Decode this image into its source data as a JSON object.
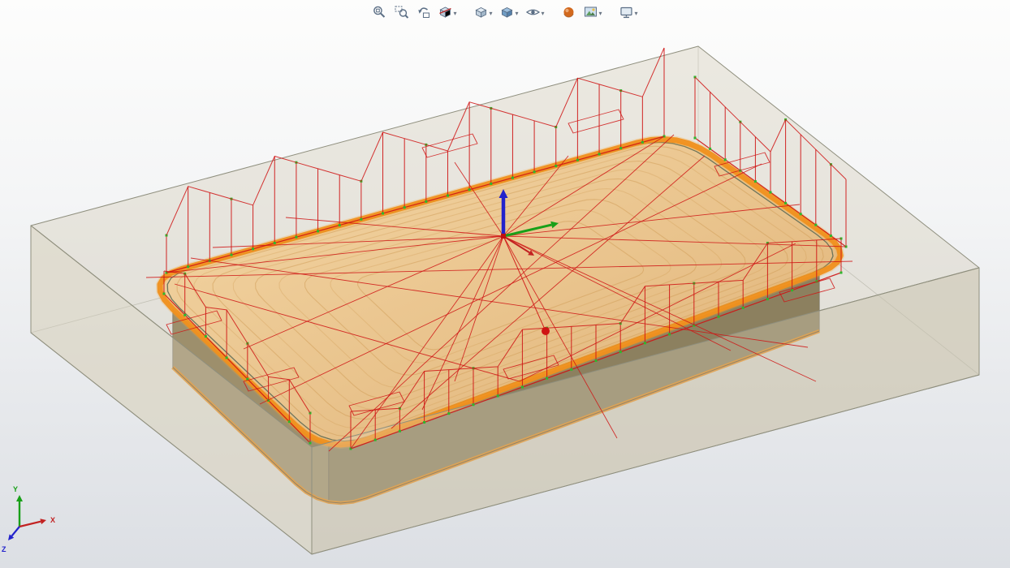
{
  "toolbar": {
    "items": [
      {
        "name": "zoom-to-fit",
        "dropdown": false,
        "group_start": false
      },
      {
        "name": "zoom-to-area",
        "dropdown": false,
        "group_start": false
      },
      {
        "name": "previous-view",
        "dropdown": false,
        "group_start": false
      },
      {
        "name": "section-view",
        "dropdown": true,
        "group_start": false
      },
      {
        "name": "view-orientation",
        "dropdown": true,
        "group_start": true
      },
      {
        "name": "display-style",
        "dropdown": true,
        "group_start": false
      },
      {
        "name": "hide-show-items",
        "dropdown": true,
        "group_start": false
      },
      {
        "name": "edit-appearance",
        "dropdown": false,
        "group_start": true
      },
      {
        "name": "apply-scene",
        "dropdown": true,
        "group_start": false
      },
      {
        "name": "view-settings",
        "dropdown": true,
        "group_start": true
      }
    ]
  },
  "triad": {
    "x_label": "X",
    "y_label": "Y",
    "z_label": "Z"
  },
  "colors": {
    "icon": "#5b6e85",
    "toolpath": "#cf1414",
    "marker": "#2db82d",
    "axis_x": "#c22222",
    "axis_y": "#18a018",
    "axis_z": "#2222cc",
    "part_top": "#eac48f",
    "part_grain": "#cf9b55",
    "part_side": "#968a66",
    "contour_band": "#f0901e",
    "stock_fill": "#d5ceba",
    "stock_edge": "#8f8f7e"
  }
}
